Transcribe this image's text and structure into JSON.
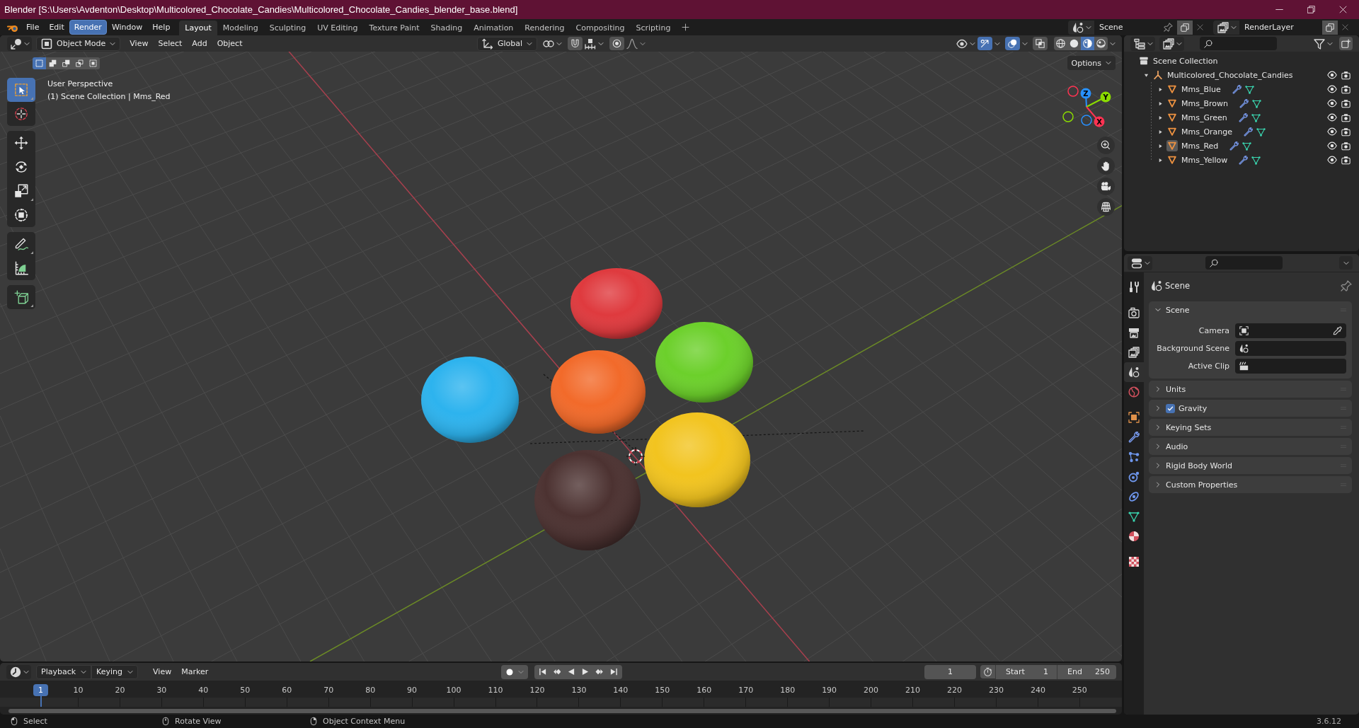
{
  "window": {
    "title": "Blender [S:\\Users\\Avdenton\\Desktop\\Multicolored_Chocolate_Candies\\Multicolored_Chocolate_Candies_blender_base.blend]"
  },
  "menu": [
    {
      "label": "File",
      "selected": false
    },
    {
      "label": "Edit",
      "selected": false
    },
    {
      "label": "Render",
      "selected": true
    },
    {
      "label": "Window",
      "selected": false
    },
    {
      "label": "Help",
      "selected": false
    }
  ],
  "workspaces": [
    {
      "label": "Layout",
      "selected": true
    },
    {
      "label": "Modeling",
      "selected": false
    },
    {
      "label": "Sculpting",
      "selected": false
    },
    {
      "label": "UV Editing",
      "selected": false
    },
    {
      "label": "Texture Paint",
      "selected": false
    },
    {
      "label": "Shading",
      "selected": false
    },
    {
      "label": "Animation",
      "selected": false
    },
    {
      "label": "Rendering",
      "selected": false
    },
    {
      "label": "Compositing",
      "selected": false
    },
    {
      "label": "Scripting",
      "selected": false
    }
  ],
  "scene_selector": {
    "value": "Scene"
  },
  "view_layer_selector": {
    "value": "RenderLayer"
  },
  "viewport": {
    "mode": "Object Mode",
    "menus": [
      "View",
      "Select",
      "Add",
      "Object"
    ],
    "orientation": "Global",
    "snap": false,
    "proportional_editing": false,
    "show_gizmos": true,
    "show_overlays": true,
    "xray": false,
    "shading_modes": [
      {
        "kind": "wireframe",
        "selected": false
      },
      {
        "kind": "solid",
        "selected": false
      },
      {
        "kind": "material",
        "selected": true
      },
      {
        "kind": "rendered",
        "selected": false
      }
    ],
    "select_modes": [
      {
        "kind": "set",
        "selected": true
      },
      {
        "kind": "extend",
        "selected": false
      },
      {
        "kind": "subtract",
        "selected": false
      },
      {
        "kind": "invert",
        "selected": false
      },
      {
        "kind": "intersect",
        "selected": false
      }
    ],
    "options": "Options",
    "overlay_text": [
      "User Perspective",
      "(1) Scene Collection | Mms_Red"
    ],
    "tool_groups": [
      {
        "tools": [
          {
            "kind": "select_box",
            "selected": true,
            "variants": true
          },
          {
            "kind": "cursor",
            "selected": false,
            "variants": false
          }
        ]
      },
      {
        "tools": [
          {
            "kind": "move",
            "selected": false,
            "variants": false
          },
          {
            "kind": "rotate",
            "selected": false,
            "variants": false
          },
          {
            "kind": "scale",
            "selected": false,
            "variants": true
          },
          {
            "kind": "transform",
            "selected": false,
            "variants": false
          }
        ]
      },
      {
        "tools": [
          {
            "kind": "annotate",
            "selected": false,
            "variants": true
          },
          {
            "kind": "measure",
            "selected": false,
            "variants": false
          }
        ]
      },
      {
        "tools": [
          {
            "kind": "add_cube",
            "selected": false,
            "variants": true
          }
        ]
      }
    ],
    "gizmo_axes": [
      {
        "label": "Z",
        "color": "#2890ff"
      },
      {
        "label": "Y",
        "color": "#8bdc00"
      },
      {
        "label": "X",
        "color": "#ff3352"
      }
    ]
  },
  "outliner": {
    "tree": [
      {
        "label": "Scene Collection",
        "kind": "scene_collection",
        "children": [
          {
            "label": "Multicolored_Chocolate_Candies",
            "kind": "collection",
            "expanded": true,
            "visible": true,
            "renderable": true,
            "children": [
              {
                "label": "Mms_Blue",
                "kind": "mesh",
                "expanded": false,
                "active": false,
                "visible": true,
                "renderable": true
              },
              {
                "label": "Mms_Brown",
                "kind": "mesh",
                "expanded": false,
                "active": false,
                "visible": true,
                "renderable": true
              },
              {
                "label": "Mms_Green",
                "kind": "mesh",
                "expanded": false,
                "active": false,
                "visible": true,
                "renderable": true
              },
              {
                "label": "Mms_Orange",
                "kind": "mesh",
                "expanded": false,
                "active": false,
                "visible": true,
                "renderable": true
              },
              {
                "label": "Mms_Red",
                "kind": "mesh",
                "expanded": false,
                "active": true,
                "visible": true,
                "renderable": true
              },
              {
                "label": "Mms_Yellow",
                "kind": "mesh",
                "expanded": false,
                "active": false,
                "visible": true,
                "renderable": true
              }
            ]
          }
        ]
      }
    ]
  },
  "properties": {
    "tab_groups": [
      {
        "tabs": [
          {
            "kind": "tool",
            "selected": false
          }
        ]
      },
      {
        "tabs": [
          {
            "kind": "render",
            "selected": false
          },
          {
            "kind": "output",
            "selected": false
          },
          {
            "kind": "view_layer",
            "selected": false
          },
          {
            "kind": "scene",
            "selected": true
          },
          {
            "kind": "world",
            "selected": false
          }
        ]
      },
      {
        "tabs": [
          {
            "kind": "object",
            "selected": false
          },
          {
            "kind": "modifiers",
            "selected": false
          },
          {
            "kind": "particles",
            "selected": false
          },
          {
            "kind": "physics",
            "selected": false
          },
          {
            "kind": "constraints",
            "selected": false
          },
          {
            "kind": "data",
            "selected": false
          },
          {
            "kind": "material",
            "selected": false
          }
        ]
      },
      {
        "tabs": [
          {
            "kind": "texture",
            "selected": false
          }
        ]
      }
    ],
    "title": "Scene",
    "panels": [
      {
        "label": "Scene",
        "kind": "plain",
        "expanded": true,
        "fields": [
          {
            "label": "Camera",
            "kind": "camera"
          },
          {
            "label": "Background Scene",
            "kind": "scene"
          },
          {
            "label": "Active Clip",
            "kind": "clip"
          }
        ]
      },
      {
        "label": "Units",
        "kind": "plain",
        "expanded": false
      },
      {
        "label": "Gravity",
        "kind": "toggle",
        "expanded": false,
        "checked": true
      },
      {
        "label": "Keying Sets",
        "kind": "plain",
        "expanded": false
      },
      {
        "label": "Audio",
        "kind": "plain",
        "expanded": false
      },
      {
        "label": "Rigid Body World",
        "kind": "plain",
        "expanded": false
      },
      {
        "label": "Custom Properties",
        "kind": "plain",
        "expanded": false
      }
    ]
  },
  "timeline": {
    "menus": [
      {
        "label": "Playback",
        "kind": "dropdown"
      },
      {
        "label": "Keying",
        "kind": "dropdown"
      },
      {
        "label": "View",
        "kind": "menu"
      },
      {
        "label": "Marker",
        "kind": "menu"
      }
    ],
    "auto_keying": false,
    "current_frame": "1",
    "start": {
      "label": "Start",
      "value": "1"
    },
    "end": {
      "label": "End",
      "value": "250"
    },
    "ruler": [
      {
        "label": "1",
        "selected": true
      },
      {
        "label": "10",
        "selected": false
      },
      {
        "label": "20",
        "selected": false
      },
      {
        "label": "30",
        "selected": false
      },
      {
        "label": "40",
        "selected": false
      },
      {
        "label": "50",
        "selected": false
      },
      {
        "label": "60",
        "selected": false
      },
      {
        "label": "70",
        "selected": false
      },
      {
        "label": "80",
        "selected": false
      },
      {
        "label": "90",
        "selected": false
      },
      {
        "label": "100",
        "selected": false
      },
      {
        "label": "110",
        "selected": false
      },
      {
        "label": "120",
        "selected": false
      },
      {
        "label": "130",
        "selected": false
      },
      {
        "label": "140",
        "selected": false
      },
      {
        "label": "150",
        "selected": false
      },
      {
        "label": "160",
        "selected": false
      },
      {
        "label": "170",
        "selected": false
      },
      {
        "label": "180",
        "selected": false
      },
      {
        "label": "190",
        "selected": false
      },
      {
        "label": "200",
        "selected": false
      },
      {
        "label": "210",
        "selected": false
      },
      {
        "label": "220",
        "selected": false
      },
      {
        "label": "230",
        "selected": false
      },
      {
        "label": "240",
        "selected": false
      },
      {
        "label": "250",
        "selected": false
      }
    ]
  },
  "status_bar": {
    "hints": [
      {
        "label": "Select",
        "kind": "left"
      },
      {
        "label": "Rotate View",
        "kind": "middle"
      },
      {
        "label": "Object Context Menu",
        "kind": "right"
      }
    ],
    "version": "3.6.12"
  }
}
